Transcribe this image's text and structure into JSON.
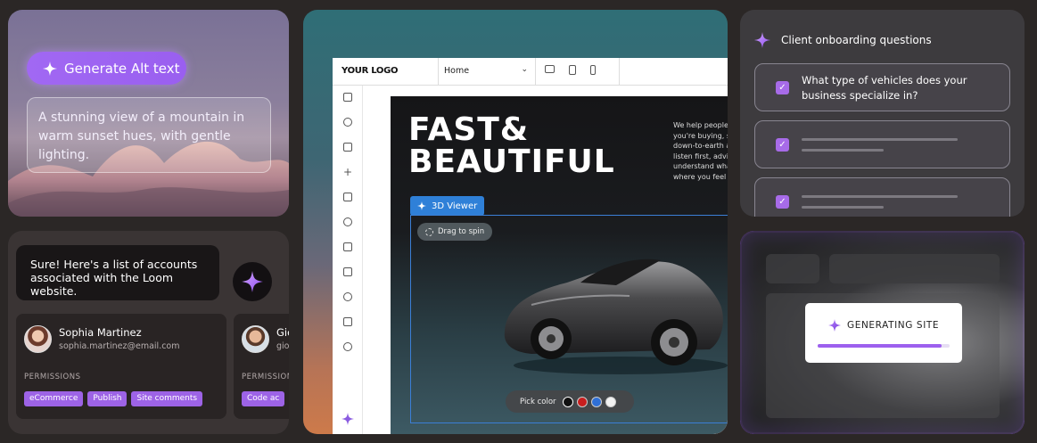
{
  "alt_text_card": {
    "button_label": "Generate Alt text",
    "description": "A stunning view of a mountain in warm sunset hues, with gentle lighting."
  },
  "chat_card": {
    "assistant_message": "Sure! Here's a list of accounts associated with the Loom website.",
    "accounts": [
      {
        "name": "Sophia Martinez",
        "email": "sophia.martinez@email.com",
        "permissions_label": "PERMISSIONS",
        "tags": [
          "eCommerce",
          "Publish",
          "Site comments"
        ]
      },
      {
        "name": "Gio",
        "email": "gio",
        "permissions_label": "PERMISSIONS",
        "tags": [
          "Code ac"
        ]
      }
    ]
  },
  "editor": {
    "logo": "YOUR LOGO",
    "page_select": "Home",
    "hero_title_line1": "FAST&",
    "hero_title_line2": "BEAUTIFUL",
    "hero_copy": "We help people t\nyou're buying, se\ndown-to-earth a\nlisten first, advise\nunderstand what\nwhere you feel at",
    "viewer_badge": "3D Viewer",
    "drag_hint": "Drag to spin",
    "pick_color_label": "Pick color",
    "color_swatches": [
      "#111111",
      "#c81e1e",
      "#2f6fd6",
      "#f2f2f2"
    ],
    "sidebar_icons": [
      "layers-icon",
      "palette-icon",
      "pages-icon",
      "plus-icon",
      "folder-icon",
      "connect-icon",
      "cart-icon",
      "media-icon",
      "chat-icon",
      "puzzle-icon",
      "settings-icon"
    ]
  },
  "onboarding": {
    "title": "Client onboarding questions",
    "questions": [
      {
        "text": "What type of vehicles does your business specialize in?",
        "checked": true
      }
    ]
  },
  "generating": {
    "label": "GENERATING SITE",
    "progress": 0.94
  },
  "colors": {
    "accent_purple": "#9d60ee",
    "viewer_blue": "#2f80d8"
  }
}
